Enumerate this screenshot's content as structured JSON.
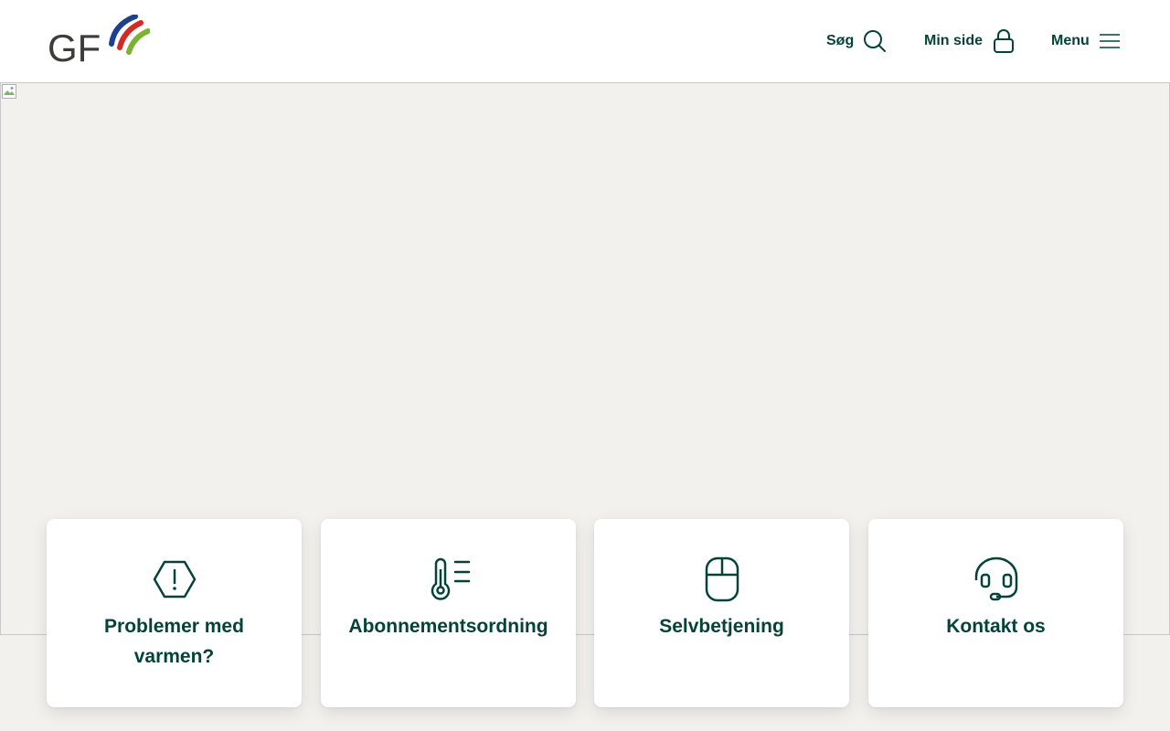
{
  "header": {
    "logo_text": "GF",
    "nav": {
      "search_label": "Søg",
      "min_side_label": "Min side",
      "menu_label": "Menu"
    }
  },
  "colors": {
    "primary": "#05433a",
    "background": "#f2f1ed",
    "logo_blue": "#1f3f8f",
    "logo_red": "#d32a27",
    "logo_green": "#7ab32e",
    "logo_gray": "#3c3c3b"
  },
  "hero": {
    "image_state": "broken-image"
  },
  "cards": [
    {
      "label": "Problemer med varmen?",
      "icon": "warning-hexagon-icon"
    },
    {
      "label": "Abonnementsordning",
      "icon": "thermometer-icon"
    },
    {
      "label": "Selvbetjening",
      "icon": "mouse-icon"
    },
    {
      "label": "Kontakt os",
      "icon": "headset-icon"
    }
  ]
}
